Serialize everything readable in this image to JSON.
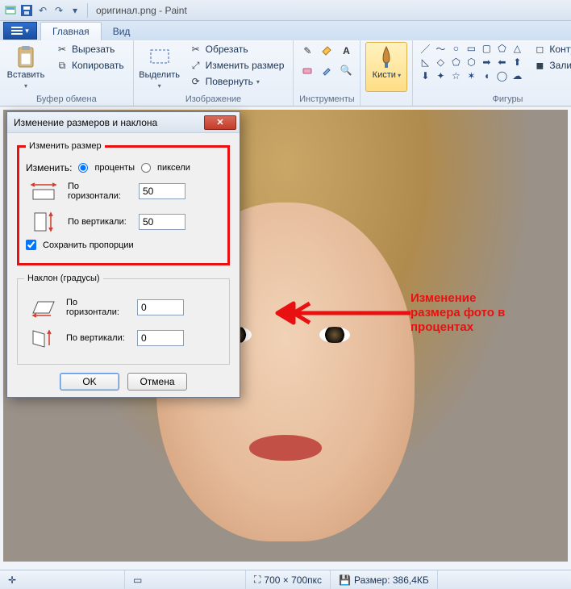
{
  "title": "оригинал.png - Paint",
  "tabs": {
    "home": "Главная",
    "view": "Вид"
  },
  "ribbon": {
    "clipboard": {
      "paste": "Вставить",
      "cut": "Вырезать",
      "copy": "Копировать",
      "label": "Буфер обмена"
    },
    "image": {
      "select": "Выделить",
      "crop": "Обрезать",
      "resize": "Изменить размер",
      "rotate": "Повернуть",
      "label": "Изображение"
    },
    "tools": {
      "label": "Инструменты"
    },
    "brushes": {
      "label": "Кисти"
    },
    "shapes": {
      "outline": "Контур",
      "fill": "Заливка",
      "label": "Фигуры"
    }
  },
  "dialog": {
    "title": "Изменение размеров и наклона",
    "resize_legend": "Изменить размер",
    "change_label": "Изменить:",
    "percent": "проценты",
    "pixels": "пиксели",
    "horizontal": "По горизонтали:",
    "vertical": "По вертикали:",
    "h_value": "50",
    "v_value": "50",
    "keep_aspect": "Сохранить пропорции",
    "skew_legend": "Наклон (градусы)",
    "skew_h": "0",
    "skew_v": "0",
    "ok": "OK",
    "cancel": "Отмена"
  },
  "annotation": "Изменение\nразмера фото в\nпроцентах",
  "status": {
    "dims": "700 × 700пкс",
    "size_label": "Размер: 386,4КБ"
  }
}
